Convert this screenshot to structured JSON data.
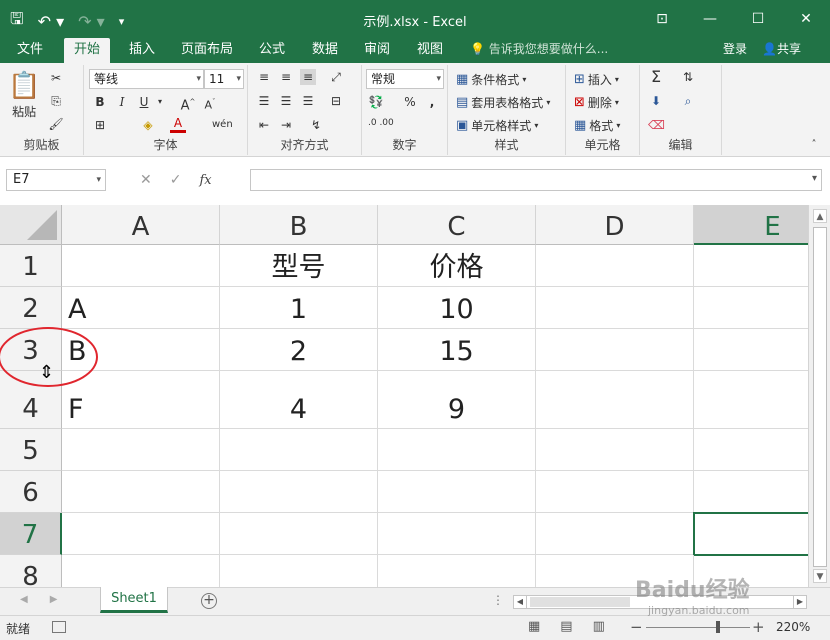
{
  "app": {
    "window_title": "示例.xlsx - Excel",
    "qat": {
      "save_icon": "save-icon",
      "undo_icon": "undo-icon",
      "redo_icon": "redo-icon"
    }
  },
  "tabs": {
    "file": "文件",
    "home": "开始",
    "insert": "插入",
    "layout": "页面布局",
    "formulas": "公式",
    "data": "数据",
    "review": "审阅",
    "view": "视图",
    "tell_me": "告诉我您想要做什么...",
    "login": "登录",
    "share": "共享"
  },
  "ribbon": {
    "clipboard": {
      "paste": "粘贴",
      "label": "剪贴板"
    },
    "font": {
      "name": "等线",
      "size": "11",
      "bold": "B",
      "italic": "I",
      "underline": "U",
      "grow": "A",
      "shrink": "A",
      "font_color": "A",
      "label": "字体"
    },
    "alignment": {
      "label": "对齐方式"
    },
    "number": {
      "format": "常规",
      "percent": "%",
      "comma": ",",
      "inc_decimal": ".0 .00",
      "label": "数字"
    },
    "styles": {
      "conditional": "条件格式",
      "table": "套用表格格式",
      "cell_styles": "单元格样式",
      "label": "样式"
    },
    "cells": {
      "insert": "插入",
      "delete": "删除",
      "format": "格式",
      "label": "单元格"
    },
    "editing": {
      "label": "编辑"
    }
  },
  "formula_bar": {
    "name_box": "E7",
    "cancel": "✕",
    "enter": "✓",
    "fx": "fx",
    "value": ""
  },
  "grid": {
    "columns": [
      "A",
      "B",
      "C",
      "D",
      "E"
    ],
    "rows": [
      "1",
      "2",
      "3",
      "4",
      "5",
      "6",
      "7",
      "8"
    ],
    "cells": {
      "B1": "型号",
      "C1": "价格",
      "A2": "A",
      "B2": "1",
      "C2": "10",
      "A3": "B",
      "B3": "2",
      "C3": "15",
      "A4": "F",
      "B4": "4",
      "C4": "9"
    },
    "active_cell": "E7"
  },
  "sheets": {
    "tabs": [
      "Sheet1"
    ]
  },
  "status": {
    "ready": "就绪",
    "zoom": "220%"
  },
  "watermark": {
    "brand": "Baidu经验",
    "url": "jingyan.baidu.com"
  },
  "colors": {
    "accent": "#217346",
    "highlight_circle": "#e0262e"
  }
}
